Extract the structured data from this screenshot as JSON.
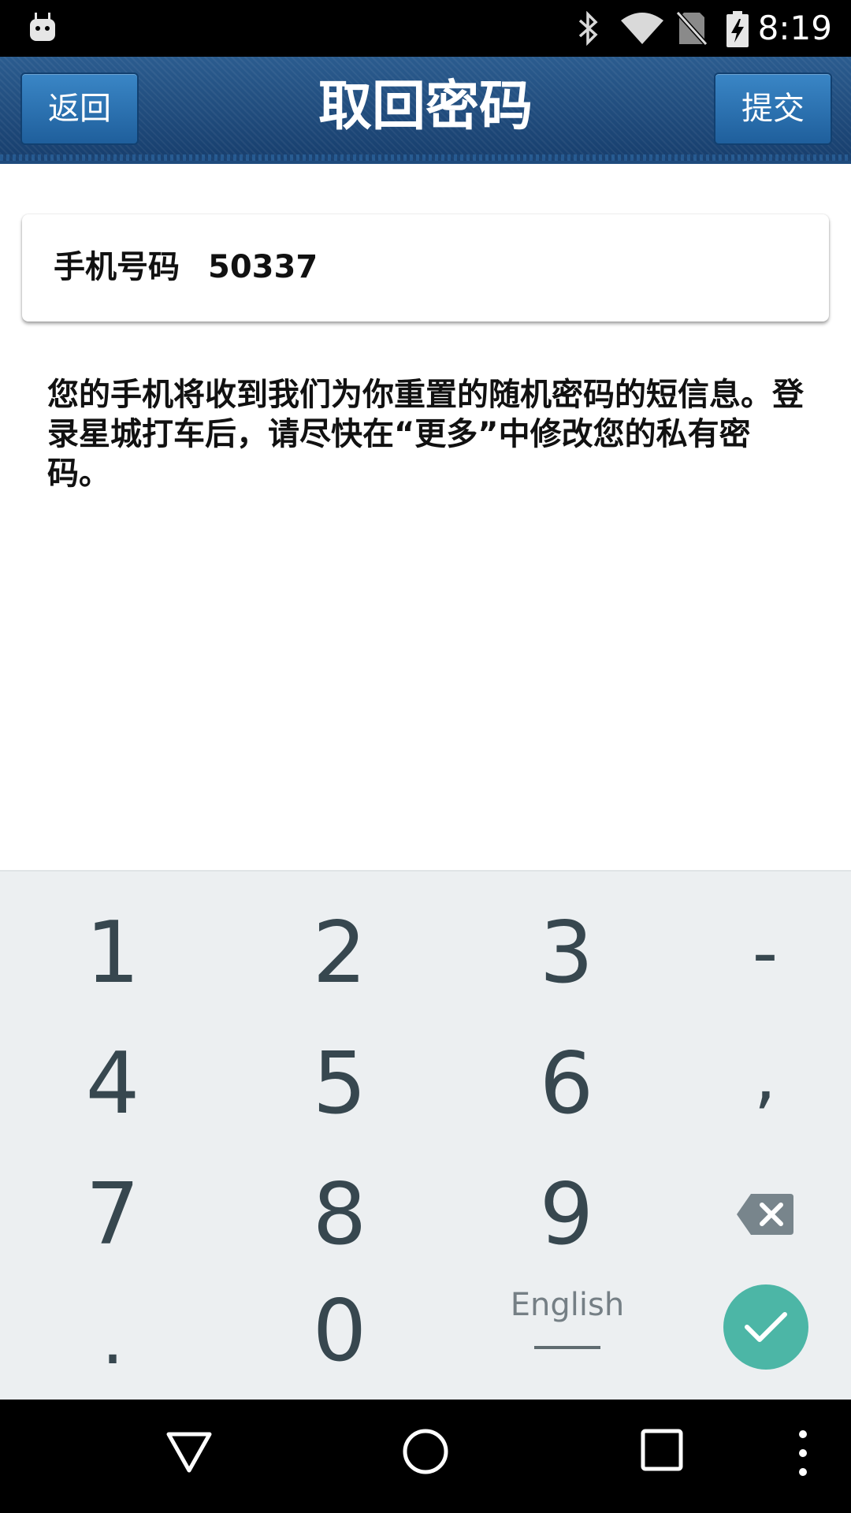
{
  "status_bar": {
    "time": "8:19",
    "icons": [
      "android-app-icon",
      "bluetooth-icon",
      "wifi-icon",
      "no-sim-icon",
      "battery-charging-icon"
    ]
  },
  "header": {
    "title": "取回密码",
    "back_label": "返回",
    "submit_label": "提交",
    "color": "#1f4b7d"
  },
  "phone_field": {
    "label": "手机号码",
    "value": "50337"
  },
  "info": {
    "text": "您的手机将收到我们为你重置的随机密码的短信息。登录星城打车后，请尽快在“更多”中修改您的私有密码。"
  },
  "keyboard": {
    "keys": [
      "1",
      "2",
      "3",
      "-",
      "4",
      "5",
      "6",
      ",",
      "7",
      "8",
      "9",
      "backspace",
      ".",
      "0"
    ],
    "rows": [
      [
        "1",
        "2",
        "3",
        "-"
      ],
      [
        "4",
        "5",
        "6",
        ","
      ],
      [
        "7",
        "8",
        "9"
      ],
      [
        ".",
        "0"
      ]
    ],
    "language_label": "English",
    "done_color": "#4cb6a6"
  },
  "nav_bar": {
    "buttons": [
      "back-icon",
      "home-icon",
      "recents-icon",
      "menu-icon"
    ]
  }
}
